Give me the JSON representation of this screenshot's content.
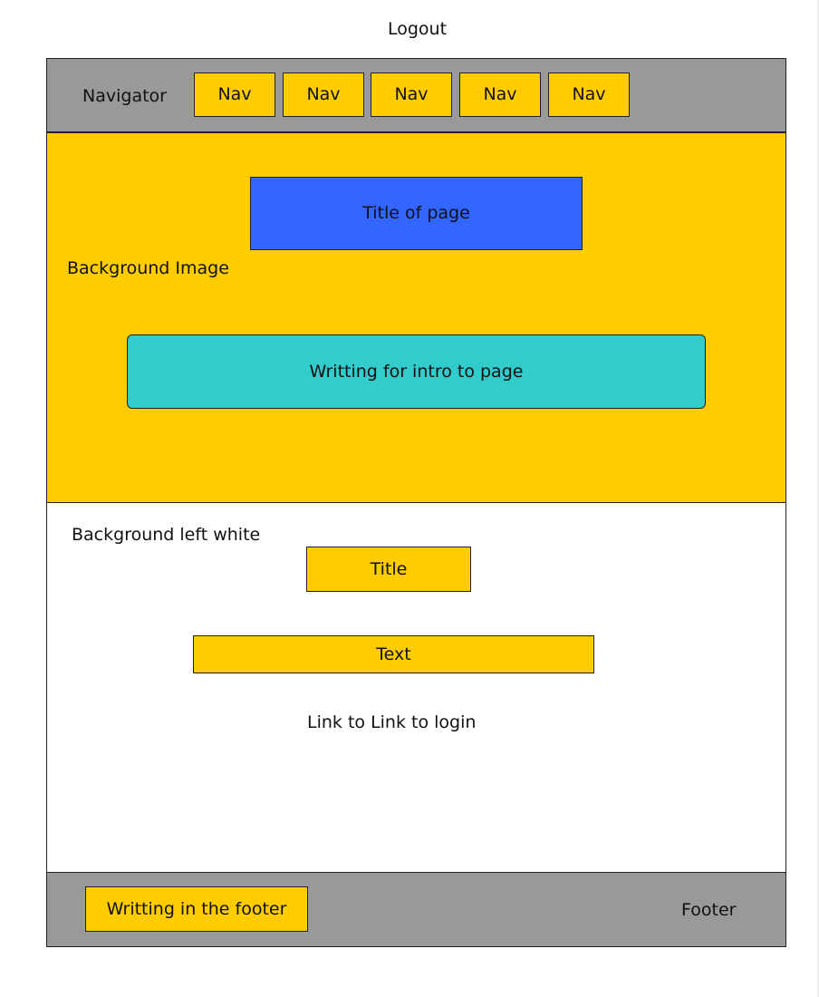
{
  "page": {
    "logout": "Logout"
  },
  "header": {
    "label": "Navigator",
    "nav_items": [
      "Nav",
      "Nav",
      "Nav",
      "Nav",
      "Nav"
    ]
  },
  "hero": {
    "background_label": "Background Image",
    "title": "Title of page",
    "intro": "Writting for intro to page"
  },
  "content": {
    "background_label": "Background left white",
    "title": "Title",
    "text": "Text",
    "link": "Link to Link to login"
  },
  "footer": {
    "writing": "Writting in the footer",
    "label": "Footer"
  },
  "colors": {
    "nav_gray": "#999999",
    "accent_yellow": "#ffcc00",
    "title_blue": "#3366ff",
    "intro_teal": "#33cccc",
    "outline": "#222222"
  }
}
